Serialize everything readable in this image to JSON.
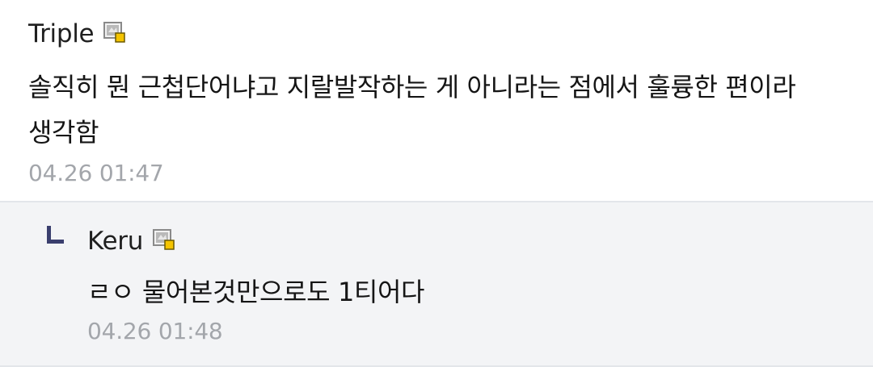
{
  "comment": {
    "nickname": "Triple",
    "user_icon": "fixed-nick-icon",
    "text": "솔직히 뭔 근첩단어냐고 지랄발작하는 게 아니라는 점에서 훌륭한 편이라 생각함",
    "timestamp": "04.26 01:47"
  },
  "reply": {
    "marker_icon": "reply-corner-icon",
    "nickname": "Keru",
    "user_icon": "fixed-nick-icon",
    "text": "ㄹㅇ 물어본것만으로도 1티어다",
    "timestamp": "04.26 01:48"
  },
  "colors": {
    "reply_background": "#f3f4f6",
    "timestamp": "#a3a6ab",
    "reply_marker": "#3a3f6e",
    "divider": "#e3e6ea"
  }
}
